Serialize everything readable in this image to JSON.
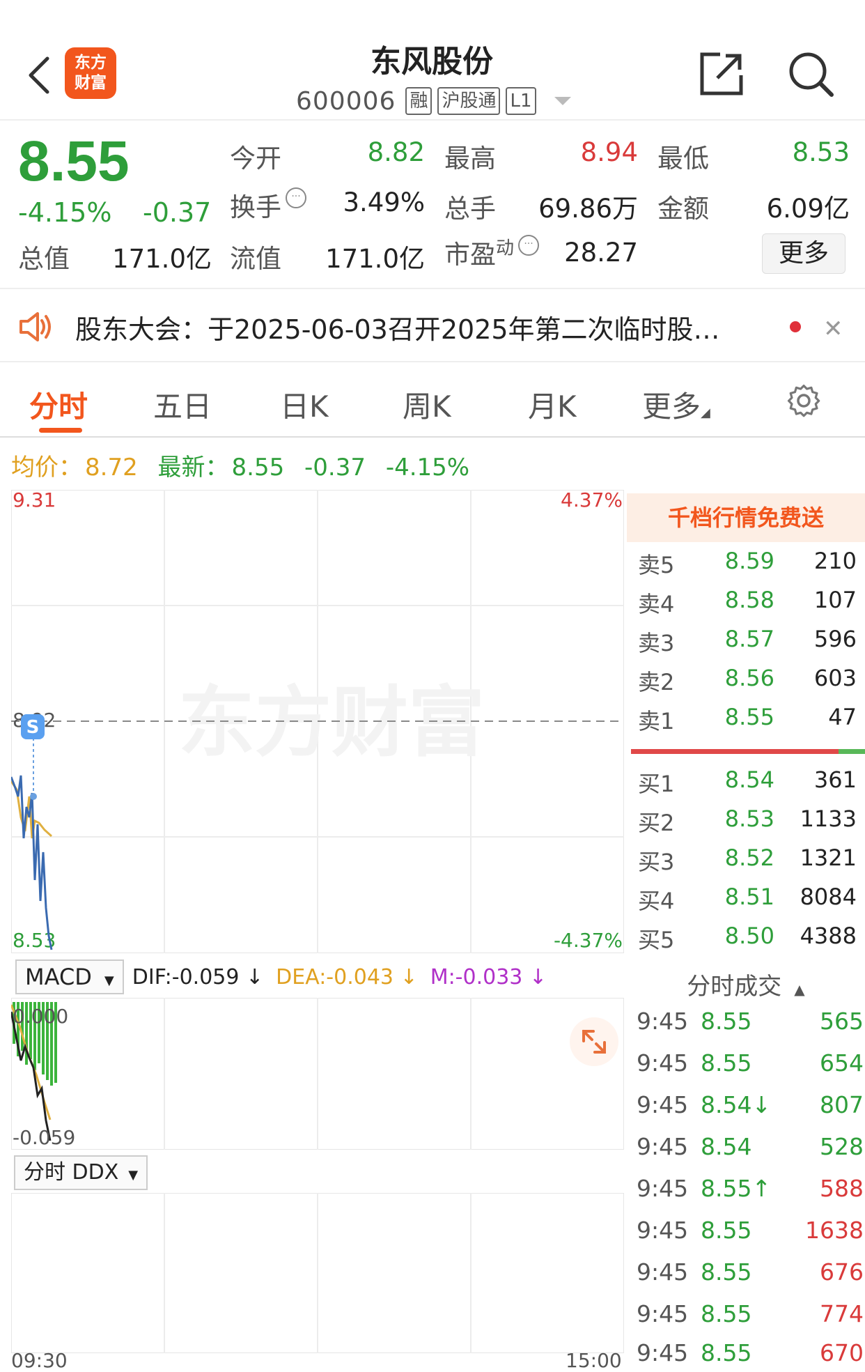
{
  "header": {
    "logo_text_1": "东方",
    "logo_text_2": "财富",
    "stock_name": "东风股份",
    "stock_code": "600006",
    "tags": [
      "融",
      "沪股通",
      "L1"
    ]
  },
  "quote": {
    "last_price": "8.55",
    "change_pct": "-4.15%",
    "change_value": "-0.37",
    "fields": {
      "open": {
        "label": "今开",
        "value": "8.82"
      },
      "high": {
        "label": "最高",
        "value": "8.94"
      },
      "low": {
        "label": "最低",
        "value": "8.53"
      },
      "turnover": {
        "label": "换手",
        "value": "3.49%"
      },
      "volume": {
        "label": "总手",
        "value": "69.86万"
      },
      "amount": {
        "label": "金额",
        "value": "6.09亿"
      },
      "total_cap": {
        "label": "总值",
        "value": "171.0亿"
      },
      "float_cap": {
        "label": "流值",
        "value": "171.0亿"
      },
      "pe": {
        "label": "市盈",
        "label_sup": "动",
        "value": "28.27"
      }
    },
    "more_label": "更多"
  },
  "notice": {
    "text": "股东大会：于2025-06-03召开2025年第二次临时股…",
    "close_glyph": "✕"
  },
  "tabs": [
    {
      "label": "分时",
      "active": true
    },
    {
      "label": "五日",
      "active": false
    },
    {
      "label": "日K",
      "active": false
    },
    {
      "label": "周K",
      "active": false
    },
    {
      "label": "月K",
      "active": false
    },
    {
      "label": "更多",
      "active": false
    }
  ],
  "avg_row": {
    "avg_label": "均价：",
    "avg_value": "8.72",
    "latest_label": "最新：",
    "latest_value": "8.55",
    "change_value": "-0.37",
    "change_pct": "-4.15%"
  },
  "main_chart": {
    "price_top": "9.31",
    "price_bottom": "8.53",
    "pct_top": "4.37%",
    "pct_bottom": "-4.37%",
    "prev_close_label": "8.92",
    "watermark": "东方财富",
    "marker": "S",
    "colors": {
      "price_line": "#3a6ab0",
      "avg_line": "#e0b040",
      "grid": "#ececec"
    }
  },
  "macd": {
    "selector": "MACD",
    "dif": "DIF:-0.059 ↓",
    "dea": "DEA:-0.043 ↓",
    "m": "M:-0.033 ↓",
    "axis_top": "0.000",
    "axis_bottom": "-0.059"
  },
  "ddx": {
    "selector": "分时 DDX"
  },
  "time_axis": {
    "start": "09:30",
    "end": "15:00"
  },
  "orderbook": {
    "banner": "千档行情免费送",
    "asks": [
      {
        "label": "卖5",
        "price": "8.59",
        "volume": "210"
      },
      {
        "label": "卖4",
        "price": "8.58",
        "volume": "107"
      },
      {
        "label": "卖3",
        "price": "8.57",
        "volume": "596"
      },
      {
        "label": "卖2",
        "price": "8.56",
        "volume": "603"
      },
      {
        "label": "卖1",
        "price": "8.55",
        "volume": "47"
      }
    ],
    "bids": [
      {
        "label": "买1",
        "price": "8.54",
        "volume": "361"
      },
      {
        "label": "买2",
        "price": "8.53",
        "volume": "1133"
      },
      {
        "label": "买3",
        "price": "8.52",
        "volume": "1321"
      },
      {
        "label": "买4",
        "price": "8.51",
        "volume": "8084"
      },
      {
        "label": "买5",
        "price": "8.50",
        "volume": "4388"
      }
    ]
  },
  "ticks": {
    "header": "分时成交",
    "rows": [
      {
        "time": "9:45",
        "price": "8.55",
        "volume": "565",
        "dir": "green"
      },
      {
        "time": "9:45",
        "price": "8.55",
        "volume": "654",
        "dir": "green"
      },
      {
        "time": "9:45",
        "price": "8.54↓",
        "volume": "807",
        "dir": "green"
      },
      {
        "time": "9:45",
        "price": "8.54",
        "volume": "528",
        "dir": "green"
      },
      {
        "time": "9:45",
        "price": "8.55↑",
        "volume": "588",
        "dir": "red"
      },
      {
        "time": "9:45",
        "price": "8.55",
        "volume": "1638",
        "dir": "red"
      },
      {
        "time": "9:45",
        "price": "8.55",
        "volume": "676",
        "dir": "red"
      },
      {
        "time": "9:45",
        "price": "8.55",
        "volume": "774",
        "dir": "red"
      },
      {
        "time": "9:45",
        "price": "8.55",
        "volume": "670",
        "dir": "red"
      }
    ]
  }
}
